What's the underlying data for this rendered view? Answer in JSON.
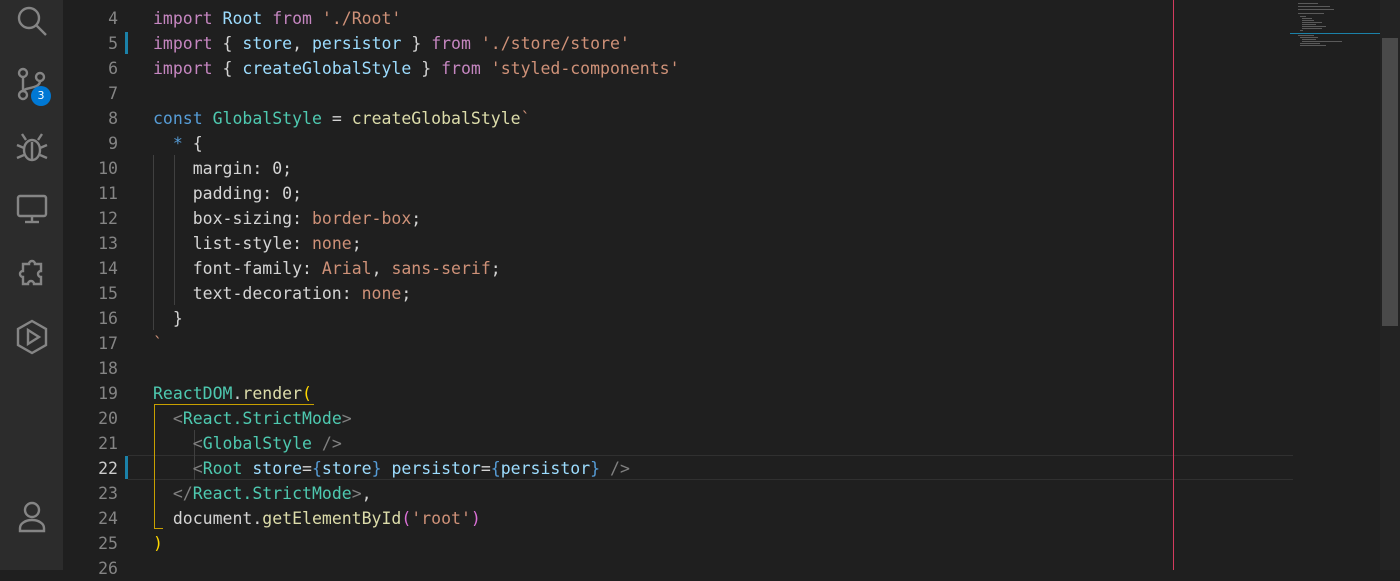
{
  "activity_bar": {
    "icons": [
      "search-icon",
      "source-control-icon",
      "run-debug-icon",
      "remote-explorer-icon",
      "extensions-icon",
      "test-explorer-icon",
      "account-icon"
    ],
    "source_control_badge": "3"
  },
  "editor": {
    "current_line": 22,
    "modified_lines": [
      5,
      22
    ],
    "lines": [
      {
        "n": "4",
        "tokens": [
          [
            "kw",
            "import "
          ],
          [
            "var",
            "Root "
          ],
          [
            "kw",
            "from "
          ],
          [
            "st",
            "'./Root'"
          ]
        ]
      },
      {
        "n": "5",
        "tokens": [
          [
            "kw",
            "import "
          ],
          [
            "pun",
            "{ "
          ],
          [
            "var",
            "store"
          ],
          [
            "pun",
            ", "
          ],
          [
            "var",
            "persistor "
          ],
          [
            "pun",
            "} "
          ],
          [
            "kw",
            "from "
          ],
          [
            "st",
            "'./store/store'"
          ]
        ]
      },
      {
        "n": "6",
        "tokens": [
          [
            "kw",
            "import "
          ],
          [
            "pun",
            "{ "
          ],
          [
            "var",
            "createGlobalStyle "
          ],
          [
            "pun",
            "} "
          ],
          [
            "kw",
            "from "
          ],
          [
            "st",
            "'styled-components'"
          ]
        ]
      },
      {
        "n": "7",
        "tokens": []
      },
      {
        "n": "8",
        "tokens": [
          [
            "blue",
            "const "
          ],
          [
            "cls",
            "GlobalStyle "
          ],
          [
            "pun",
            "= "
          ],
          [
            "fn",
            "createGlobalStyle"
          ],
          [
            "st",
            "`"
          ]
        ]
      },
      {
        "n": "9",
        "tokens": [
          [
            "pun",
            "  "
          ],
          [
            "blue",
            "* "
          ],
          [
            "pun",
            "{"
          ]
        ]
      },
      {
        "n": "10",
        "tokens": [
          [
            "pun",
            "    margin: "
          ],
          [
            "pun",
            "0;"
          ]
        ]
      },
      {
        "n": "11",
        "tokens": [
          [
            "pun",
            "    padding: "
          ],
          [
            "pun",
            "0;"
          ]
        ]
      },
      {
        "n": "12",
        "tokens": [
          [
            "pun",
            "    box-sizing: "
          ],
          [
            "st",
            "border-box"
          ],
          [
            "pun",
            ";"
          ]
        ]
      },
      {
        "n": "13",
        "tokens": [
          [
            "pun",
            "    list-style: "
          ],
          [
            "st",
            "none"
          ],
          [
            "pun",
            ";"
          ]
        ]
      },
      {
        "n": "14",
        "tokens": [
          [
            "pun",
            "    font-family: "
          ],
          [
            "st",
            "Arial"
          ],
          [
            "pun",
            ", "
          ],
          [
            "st",
            "sans-serif"
          ],
          [
            "pun",
            ";"
          ]
        ]
      },
      {
        "n": "15",
        "tokens": [
          [
            "pun",
            "    text-decoration: "
          ],
          [
            "st",
            "none"
          ],
          [
            "pun",
            ";"
          ]
        ]
      },
      {
        "n": "16",
        "tokens": [
          [
            "pun",
            "  }"
          ]
        ]
      },
      {
        "n": "17",
        "tokens": [
          [
            "st",
            "`"
          ]
        ]
      },
      {
        "n": "18",
        "tokens": []
      },
      {
        "n": "19",
        "tokens": [
          [
            "cls",
            "ReactDOM"
          ],
          [
            "pun",
            "."
          ],
          [
            "fn",
            "render"
          ],
          [
            "gold",
            "("
          ]
        ]
      },
      {
        "n": "20",
        "tokens": [
          [
            "pun",
            "  "
          ],
          [
            "tag",
            "<"
          ],
          [
            "cls",
            "React.StrictMode"
          ],
          [
            "tag",
            ">"
          ]
        ]
      },
      {
        "n": "21",
        "tokens": [
          [
            "pun",
            "    "
          ],
          [
            "tag",
            "<"
          ],
          [
            "cls",
            "GlobalStyle "
          ],
          [
            "tag",
            "/>"
          ]
        ]
      },
      {
        "n": "22",
        "tokens": [
          [
            "pun",
            "    "
          ],
          [
            "tag",
            "<"
          ],
          [
            "cls",
            "Root "
          ],
          [
            "var",
            "store"
          ],
          [
            "pun",
            "="
          ],
          [
            "blue",
            "{"
          ],
          [
            "var",
            "store"
          ],
          [
            "blue",
            "} "
          ],
          [
            "var",
            "persistor"
          ],
          [
            "pun",
            "="
          ],
          [
            "blue",
            "{"
          ],
          [
            "var",
            "persistor"
          ],
          [
            "blue",
            "} "
          ],
          [
            "tag",
            "/>"
          ]
        ]
      },
      {
        "n": "23",
        "tokens": [
          [
            "pun",
            "  "
          ],
          [
            "tag",
            "</"
          ],
          [
            "cls",
            "React.StrictMode"
          ],
          [
            "tag",
            ">"
          ],
          [
            "pun",
            ","
          ]
        ]
      },
      {
        "n": "24",
        "tokens": [
          [
            "pun",
            "  document."
          ],
          [
            "fn",
            "getElementById"
          ],
          [
            "pink",
            "("
          ],
          [
            "st",
            "'root'"
          ],
          [
            "pink",
            ")"
          ]
        ]
      },
      {
        "n": "25",
        "tokens": [
          [
            "gold",
            ")"
          ]
        ]
      },
      {
        "n": "26",
        "tokens": []
      }
    ]
  }
}
